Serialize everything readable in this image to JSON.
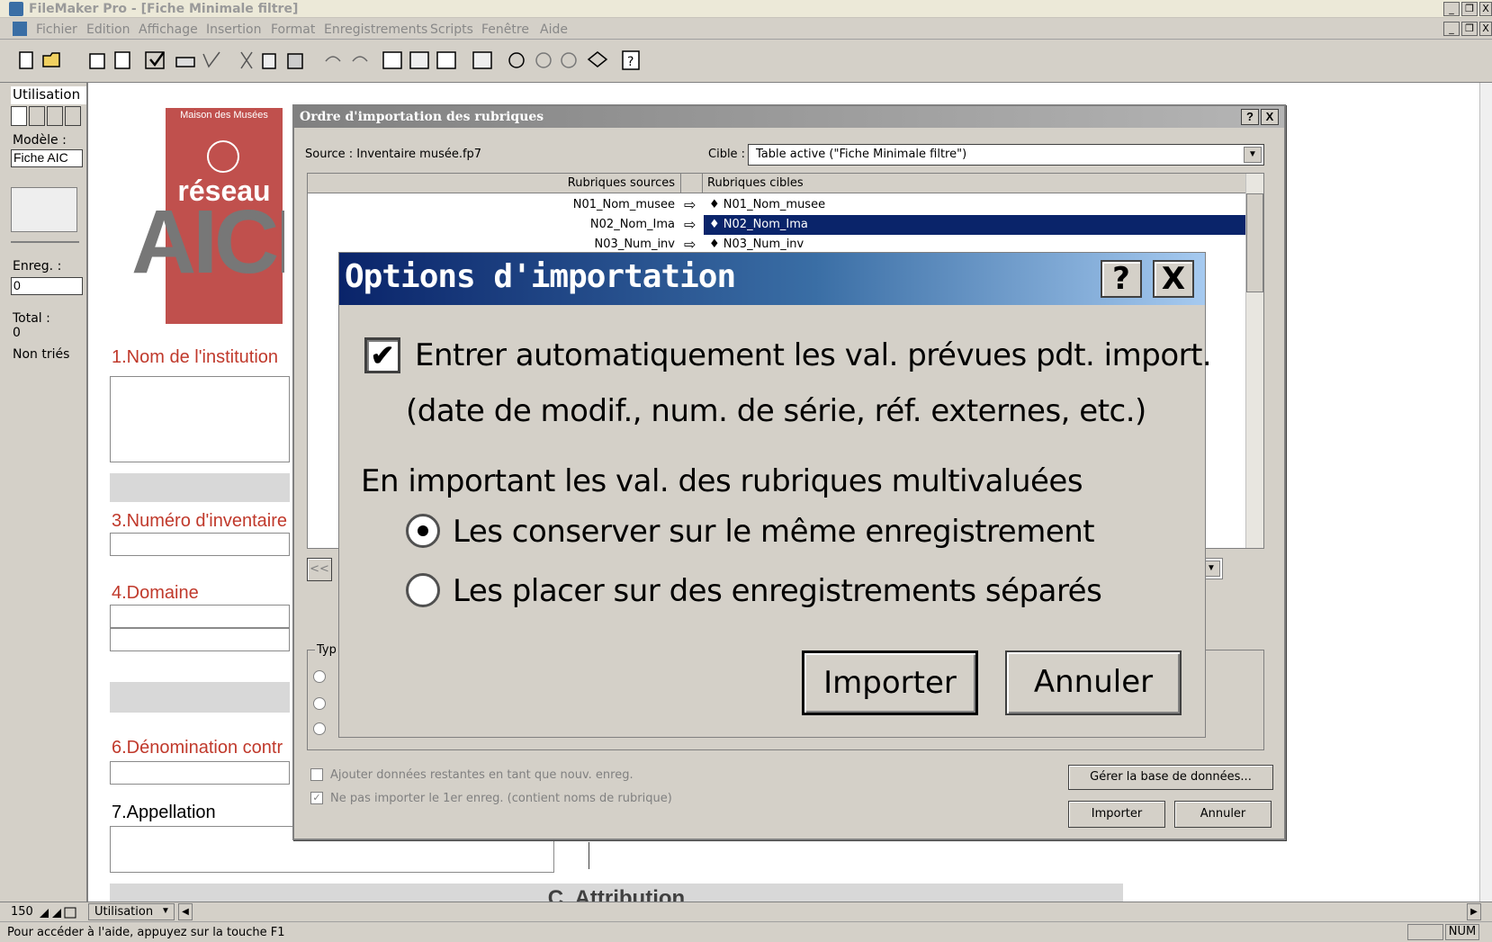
{
  "app": {
    "window_title": "FileMaker Pro - [Fiche Minimale filtre]",
    "min_label": "_",
    "restore_label": "❐",
    "close_label": "X"
  },
  "menu": [
    "Fichier",
    "Edition",
    "Affichage",
    "Insertion",
    "Format",
    "Enregistrements",
    "Scripts",
    "Fenêtre",
    "Aide"
  ],
  "status_area": {
    "mode_label": "Utilisation",
    "layout_label": "Modèle :",
    "layout_value": "Fiche AIC",
    "records_label": "Enreg. :",
    "record_value": "0",
    "total_label": "Total :",
    "total_value": "0",
    "sort_state": "Non triés"
  },
  "layout": {
    "logo_top": "Maison des Musées",
    "logo_main": "réseau",
    "logo_big": "AICIN",
    "fields": [
      {
        "label": "1.Nom de l'institution"
      },
      {
        "label": "3.Numéro d'inventaire"
      },
      {
        "label": "4.Domaine"
      },
      {
        "label": "6.Dénomination contr"
      },
      {
        "label": "7.Appellation"
      }
    ],
    "section_c": "C. Attribution"
  },
  "order_dialog": {
    "title": "Ordre d'importation des rubriques",
    "help": "?",
    "close": "X",
    "source_label": "Source : Inventaire musée.fp7",
    "target_label": "Cible :",
    "target_value": "Table active (\"Fiche Minimale filtre\")",
    "col_source": "Rubriques sources",
    "col_target": "Rubriques cibles",
    "rows": [
      {
        "source": "N01_Nom_musee",
        "target": "N01_Nom_musee",
        "selected": false
      },
      {
        "source": "N02_Nom_Ima",
        "target": "N02_Nom_Ima",
        "selected": true
      },
      {
        "source": "N03_Num_inv",
        "target": "N03_Num_inv",
        "selected": false
      }
    ],
    "nav_prev": "<<",
    "type_group": "Typ",
    "opt_add": "Ajouter données restantes en tant que nouv. enreg.",
    "opt_skip": "Ne pas importer le 1er enreg. (contient noms de rubrique)",
    "manage_db": "Gérer la base de données...",
    "import": "Importer",
    "cancel": "Annuler"
  },
  "options_dialog": {
    "title": "Options d'importation",
    "help": "?",
    "close": "X",
    "auto_enter": "Entrer automatiquement les val. prévues pdt. import.",
    "auto_enter_sub": "(date de modif., num. de série, réf. externes, etc.)",
    "auto_enter_checked": true,
    "repeat_heading": "En important les val. des rubriques multivaluées",
    "keep_same": "Les conserver sur le même enregistrement",
    "split_records": "Les placer sur des enregistrements séparés",
    "selected_option": "keep_same",
    "import": "Importer",
    "cancel": "Annuler"
  },
  "bottom": {
    "zoom": "150",
    "mode": "Utilisation",
    "help_hint": "Pour accéder à l'aide, appuyez sur la touche F1",
    "num": "NUM"
  }
}
